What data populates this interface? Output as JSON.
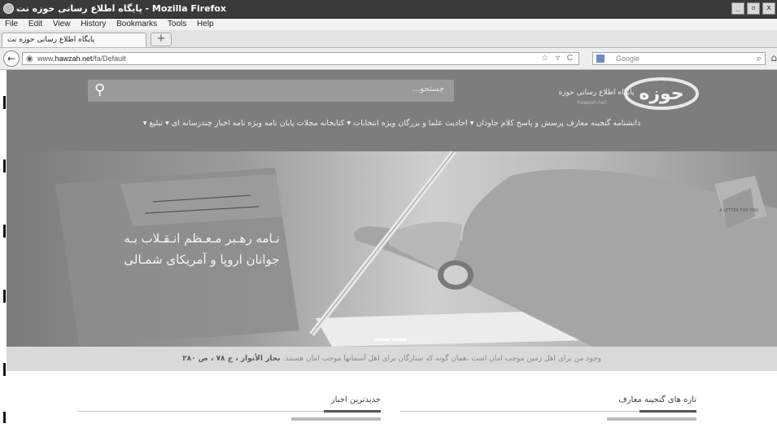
{
  "window": {
    "title": "پایگاه اطلاع رسانی حوزه نت - Mozilla Firefox",
    "buttons": [
      "_",
      "▫",
      "x"
    ]
  },
  "menu": [
    "File",
    "Edit",
    "View",
    "History",
    "Bookmarks",
    "Tools",
    "Help"
  ],
  "tab": {
    "label": "پایگاه اطلاع رسانی حوزه نت",
    "new_tab": "+"
  },
  "navbar": {
    "back": "←",
    "url_prefix": "www.",
    "url_host": "hawzah.net",
    "url_path": "/fa/Default",
    "url_icons": "☆ ▿ C",
    "search_placeholder": "Google",
    "search_icon": "⌕",
    "home_icon": "⌂"
  },
  "header": {
    "search_placeholder": "جستجو...",
    "search_icon": "⚲",
    "logo_text": "حوزه",
    "logo_tagline": "پایگاه اطلاع رسانی حوزه",
    "logo_sub": "Hawzah.net",
    "nav": "دانشنامه گنجینه معارف پرسش و پاسخ کلام جاودان ▾ احادیث علما و بزرگان ویژه انتخابات ▾ کتابخانه مجلات پایان نامه ویژه نامه اخبار چندرسانه ای ▾ تبلیغ ▾"
  },
  "hero": {
    "line1": "نـامه رهـبر مـعـظم انـقـلاب بـه",
    "line2": "جوانان اروپا و آمریکای شمـالی",
    "badge_text": "A LETTER FOR YOU",
    "slides": 2
  },
  "quote": {
    "text": "وجود من برای اهل زمین موجب امان است ،همان گونه که ستارگان برای اهل آسمانها موجب امان هستند.",
    "source": "بحار الأنوار ، ج ۷۸ ، ص ۳۸۰"
  },
  "sections": {
    "news_title": "جدیدترین اخبار",
    "treasure_title": "تازه های گنجینه معارف"
  },
  "colors": {
    "header_bg": "#7d7d7d",
    "titlebar_bg": "#3a3a3a",
    "quote_bg": "#d9d9d9"
  }
}
